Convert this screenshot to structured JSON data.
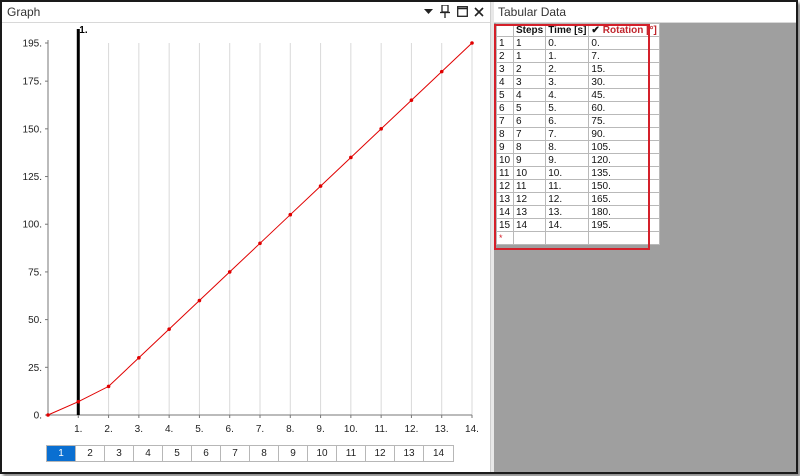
{
  "graph_panel": {
    "title": "Graph",
    "icons": [
      "dropdown-icon",
      "pin-icon",
      "maximize-icon",
      "close-icon"
    ],
    "current_step_label": "1.",
    "step_tabs": [
      "1",
      "2",
      "3",
      "4",
      "5",
      "6",
      "7",
      "8",
      "9",
      "10",
      "11",
      "12",
      "13",
      "14"
    ],
    "active_step": "1"
  },
  "tabular_panel": {
    "title": "Tabular Data",
    "columns": [
      "Steps",
      "Time [s]",
      "Rotation [°]"
    ],
    "new_row_marker": "*",
    "rows": [
      [
        "1",
        "1",
        "0.",
        "0."
      ],
      [
        "2",
        "1",
        "1.",
        "7."
      ],
      [
        "3",
        "2",
        "2.",
        "15."
      ],
      [
        "4",
        "3",
        "3.",
        "30."
      ],
      [
        "5",
        "4",
        "4.",
        "45."
      ],
      [
        "6",
        "5",
        "5.",
        "60."
      ],
      [
        "7",
        "6",
        "6.",
        "75."
      ],
      [
        "8",
        "7",
        "7.",
        "90."
      ],
      [
        "9",
        "8",
        "8.",
        "105."
      ],
      [
        "10",
        "9",
        "9.",
        "120."
      ],
      [
        "11",
        "10",
        "10.",
        "135."
      ],
      [
        "12",
        "11",
        "11.",
        "150."
      ],
      [
        "13",
        "12",
        "12.",
        "165."
      ],
      [
        "14",
        "13",
        "13.",
        "180."
      ],
      [
        "15",
        "14",
        "14.",
        "195."
      ]
    ]
  },
  "chart_data": {
    "type": "line",
    "title": "",
    "xlabel": "",
    "ylabel": "",
    "x": [
      0,
      1,
      2,
      3,
      4,
      5,
      6,
      7,
      8,
      9,
      10,
      11,
      12,
      13,
      14
    ],
    "series": [
      {
        "values": [
          0,
          7,
          15,
          30,
          45,
          60,
          75,
          90,
          105,
          120,
          135,
          150,
          165,
          180,
          195
        ],
        "color": "#e00000"
      }
    ],
    "xticks": [
      "1.",
      "2.",
      "3.",
      "4.",
      "5.",
      "6.",
      "7.",
      "8.",
      "9.",
      "10.",
      "11.",
      "12.",
      "13.",
      "14."
    ],
    "yticks": [
      "0.",
      "25.",
      "50.",
      "75.",
      "100.",
      "125.",
      "150.",
      "175.",
      "195."
    ],
    "ytick_values": [
      0,
      25,
      50,
      75,
      100,
      125,
      150,
      175,
      195
    ],
    "xlim": [
      0,
      14
    ],
    "ylim": [
      0,
      195
    ],
    "vertical_grid": true,
    "marker_x": 1,
    "marker_label": "1."
  }
}
